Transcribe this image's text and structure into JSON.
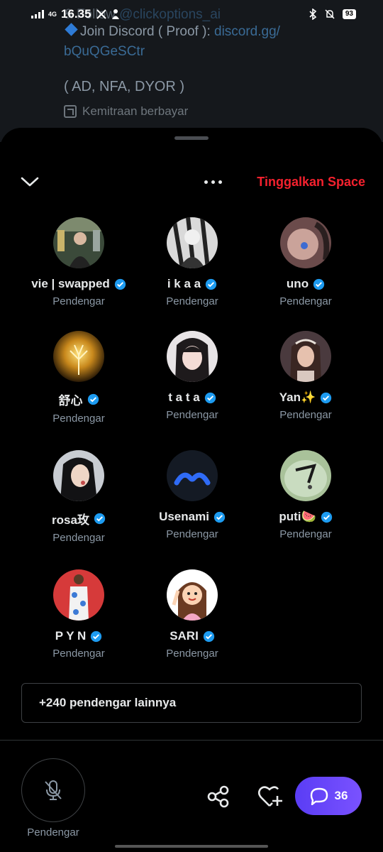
{
  "status_bar": {
    "time": "16.35",
    "network": "4G",
    "battery": "93"
  },
  "background_tweet": {
    "line0_text": "& Follow ",
    "line0_link": "@clickoptions_ai",
    "line1_text": "Join Discord ( Proof ): ",
    "line1_link": "discord.gg/",
    "line2_link": "bQuQGeSCtr",
    "line3": "( AD, NFA, DYOR )",
    "promo_label": "Kemitraan berbayar"
  },
  "header": {
    "leave_label": "Tinggalkan Space"
  },
  "listeners": [
    {
      "name": "vie | swapped",
      "role": "Pendengar"
    },
    {
      "name": "i k a a",
      "role": "Pendengar"
    },
    {
      "name": "uno",
      "role": "Pendengar"
    },
    {
      "name": "舒心",
      "role": "Pendengar"
    },
    {
      "name": "t a t a",
      "role": "Pendengar"
    },
    {
      "name": "Yan✨",
      "role": "Pendengar"
    },
    {
      "name": "rosa玫",
      "role": "Pendengar"
    },
    {
      "name": "Usenami",
      "role": "Pendengar"
    },
    {
      "name": "puti🍉",
      "role": "Pendengar"
    },
    {
      "name": "P Y N",
      "role": "Pendengar"
    },
    {
      "name": "SARI",
      "role": "Pendengar"
    }
  ],
  "more_listeners_label": "+240 pendengar lainnya",
  "footer": {
    "mic_label": "Pendengar",
    "chat_count": "36"
  },
  "colors": {
    "accent": "#f4212e",
    "verified": "#1d9bf0",
    "chat_gradient": "#6a48fa"
  }
}
